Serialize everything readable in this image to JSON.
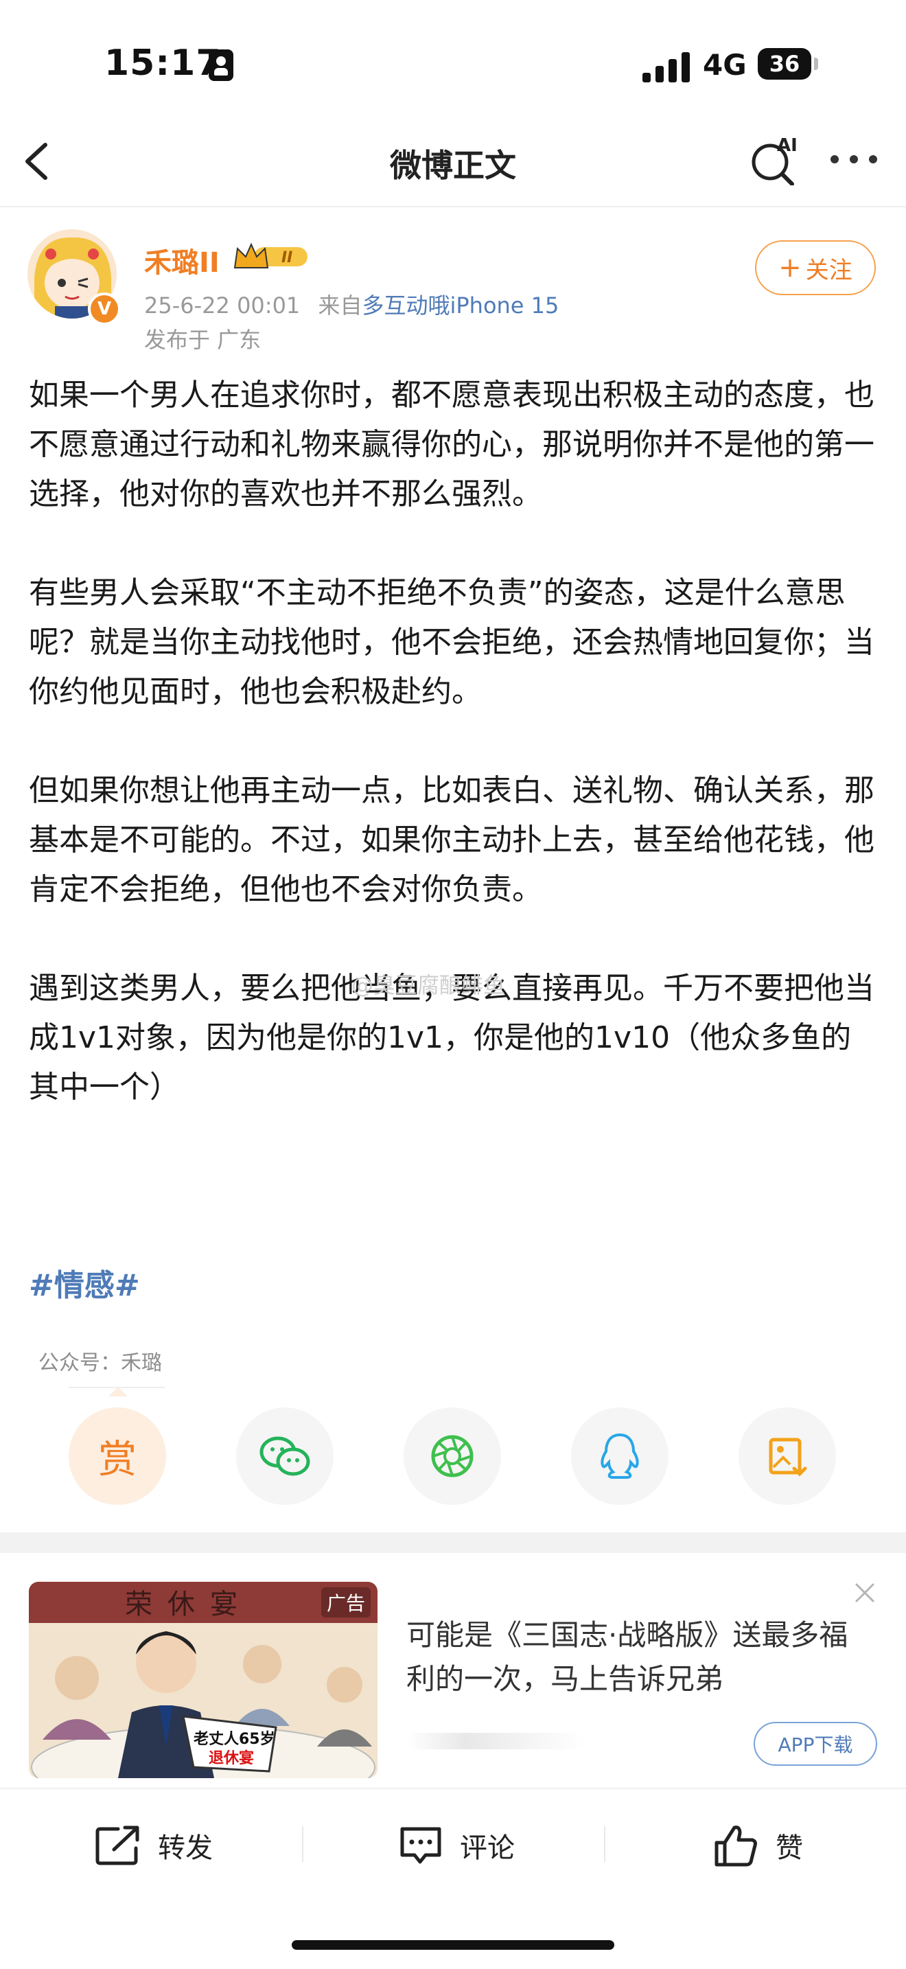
{
  "status_bar": {
    "time": "15:17",
    "network": "4G",
    "battery": "36"
  },
  "nav": {
    "title": "微博正文",
    "ai_label": "AI"
  },
  "author": {
    "name": "禾璐II",
    "level_badge": "II",
    "verified_badge": "V",
    "time": "25-6-22 00:01",
    "source_prefix": "来自",
    "source": "多互动哦iPhone 15",
    "location": "发布于 广东",
    "follow_label": "关注"
  },
  "post": {
    "paragraphs": [
      "如果一个男人在追求你时，都不愿意表现出积极主动的态度，也不愿意通过行动和礼物来赢得你的心，那说明你并不是他的第一选择，他对你的喜欢也并不那么强烈。",
      "有些男人会采取“不主动不拒绝不负责”的姿态，这是什么意思呢？就是当你主动找他时，他不会拒绝，还会热情地回复你；当你约他见面时，他也会积极赴约。",
      "但如果你想让他再主动一点，比如表白、送礼物、确认关系，那基本是不可能的。不过，如果你主动扑上去，甚至给他花钱，他肯定不会拒绝，但他也不会对你负责。",
      "遇到这类男人，要么把他当鱼，要么直接再见。千万不要把他当成1v1对象，因为他是你的1v1，你是他的1v10（他众多鱼的其中一个）"
    ],
    "hashtag": "#情感#",
    "watermark": "@臭豆腐酿鲱鱼",
    "public_account": "公众号：禾璐"
  },
  "share": {
    "reward_label": "赏",
    "icons": [
      "wechat-icon",
      "moments-icon",
      "qq-icon",
      "save-image-icon"
    ]
  },
  "ad": {
    "tag": "广告",
    "banner_text": "荣休宴",
    "sign_text_1": "老丈人65岁",
    "sign_text_2": "退休宴",
    "text": "可能是《三国志·战略版》送最多福利的一次，马上告诉兄弟",
    "button": "APP下载"
  },
  "bottom_bar": {
    "repost": "转发",
    "comment": "评论",
    "like": "赞"
  },
  "colors": {
    "accent_orange": "#f07e24",
    "link_blue": "#4f7bb7"
  }
}
